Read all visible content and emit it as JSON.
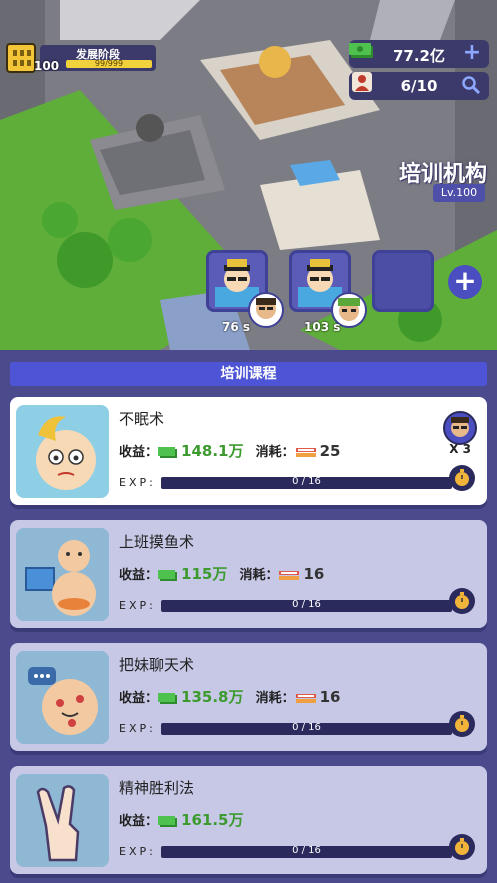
{
  "hud": {
    "stage_level": "100",
    "stage_title": "发展阶段",
    "stage_progress_text": "99/999",
    "stage_progress": 0.99,
    "money": "77.2亿",
    "staff": "6/10",
    "money_icon": "cash-icon",
    "staff_icon": "person-icon",
    "add_icon": "plus-icon",
    "search_icon": "search-icon"
  },
  "institute": {
    "name": "培训机构",
    "level": "Lv.100"
  },
  "slots": [
    {
      "time": "76 s",
      "state": "training"
    },
    {
      "time": "103 s",
      "state": "training"
    },
    {
      "time": "",
      "state": "empty"
    }
  ],
  "section_title": "培训课程",
  "courses": [
    {
      "name": "不眠术",
      "income_label": "收益：",
      "income": "148.1万",
      "cost_label": "消耗：",
      "cost": "25",
      "exp_label": "EXP:",
      "exp_text": "0 / 16",
      "exp": 0,
      "assigned_count": "X 3",
      "active": true
    },
    {
      "name": "上班摸鱼术",
      "income_label": "收益：",
      "income": "115万",
      "cost_label": "消耗：",
      "cost": "16",
      "exp_label": "EXP:",
      "exp_text": "0 / 16",
      "exp": 0,
      "active": false
    },
    {
      "name": "把妹聊天术",
      "income_label": "收益：",
      "income": "135.8万",
      "cost_label": "消耗：",
      "cost": "16",
      "exp_label": "EXP:",
      "exp_text": "0 / 16",
      "exp": 0,
      "active": false
    },
    {
      "name": "精神胜利法",
      "income_label": "收益：",
      "income": "161.5万",
      "exp_label": "EXP:",
      "exp_text": "0 / 16",
      "exp": 0,
      "active": false
    }
  ],
  "colors": {
    "accent": "#4d55d6",
    "panel": "#4a4a8c",
    "income": "#3c9a2e"
  }
}
